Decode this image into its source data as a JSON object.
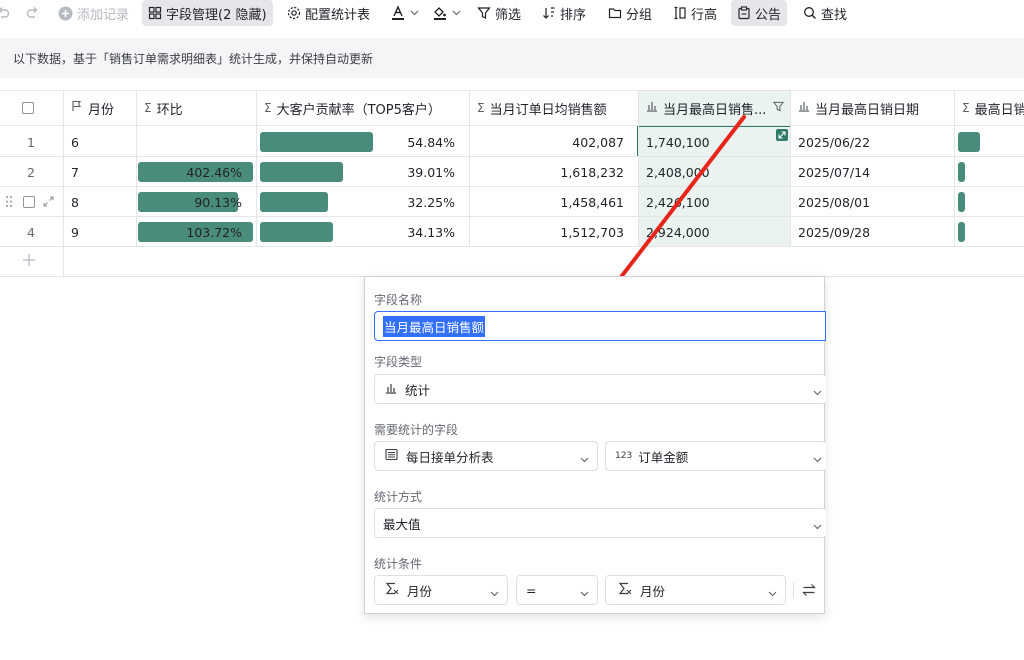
{
  "toolbar": {
    "add_record": "添加记录",
    "field_manage": "字段管理(2 隐藏)",
    "config_stats": "配置统计表",
    "filter": "筛选",
    "sort": "排序",
    "group": "分组",
    "row_height": "行高",
    "notice": "公告",
    "find": "查找"
  },
  "notice_text": "以下数据，基于「销售订单需求明细表」统计生成，并保持自动更新",
  "columns": {
    "month": "月份",
    "mom": "环比",
    "top5": "大客户贡献率（TOP5客户）",
    "avg_daily": "当月订单日均销售额",
    "max_daily": "当月最高日销售...",
    "max_date": "当月最高日销日期",
    "max_daily_2": "最高日销"
  },
  "rows": [
    {
      "num": "1",
      "month": "6",
      "mom": "",
      "mom_pct": 0,
      "top5": "54.84%",
      "top5_pct": 0.9,
      "avg": "402,087",
      "max": "1,740,100",
      "date": "2025/06/22",
      "last_pct": 0.9
    },
    {
      "num": "2",
      "month": "7",
      "mom": "402.46%",
      "mom_pct": 1.0,
      "top5": "39.01%",
      "top5_pct": 0.66,
      "avg": "1,618,232",
      "max": "2,408,000",
      "date": "2025/07/14",
      "last_pct": 0.3
    },
    {
      "num": "3",
      "month": "8",
      "mom": "90.13%",
      "mom_pct": 0.87,
      "top5": "32.25%",
      "top5_pct": 0.54,
      "avg": "1,458,461",
      "max": "2,426,100",
      "date": "2025/08/01",
      "last_pct": 0.3
    },
    {
      "num": "4",
      "month": "9",
      "mom": "103.72%",
      "mom_pct": 1.0,
      "top5": "34.13%",
      "top5_pct": 0.58,
      "avg": "1,512,703",
      "max": "2,924,000",
      "date": "2025/09/28",
      "last_pct": 0.3
    }
  ],
  "colors": {
    "bar": "#4a8c7b",
    "selected_col": "#eaf3ef",
    "accent": "#3370ff",
    "arrow": "#e8251b"
  },
  "panel": {
    "field_name_label": "字段名称",
    "field_name_value": "当月最高日销售额",
    "field_type_label": "字段类型",
    "field_type_value": "统计",
    "stat_field_label": "需要统计的字段",
    "source_table": "每日接单分析表",
    "source_field": "订单金额",
    "method_label": "统计方式",
    "method_value": "最大值",
    "condition_label": "统计条件",
    "cond_left": "月份",
    "cond_op": "=",
    "cond_right": "月份"
  }
}
